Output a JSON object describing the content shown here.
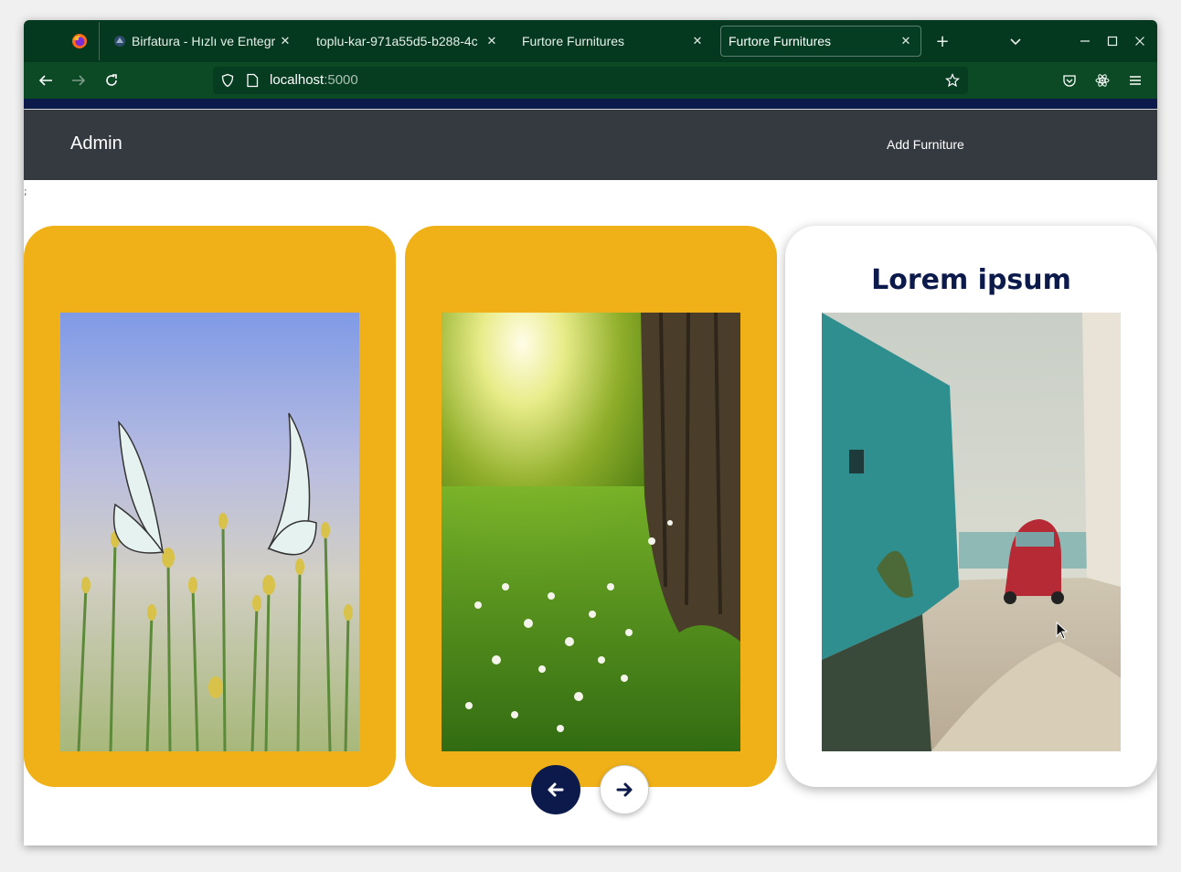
{
  "browser": {
    "tabs": [
      {
        "title": "Birfatura - Hızlı ve Entegr",
        "active": false
      },
      {
        "title": "toplu-kar-971a55d5-b288-4c",
        "active": false
      },
      {
        "title": "Furtore Furnitures",
        "active": false
      },
      {
        "title": "Furtore Furnitures",
        "active": true
      }
    ],
    "url_host": "localhost",
    "url_port": ":5000",
    "accent_color": "#04391f"
  },
  "page": {
    "brand": "Admin",
    "nav_link": "Add Furniture",
    "stray_text": ";",
    "cards": [
      {
        "style": "yellow",
        "title": "",
        "image": "butterflies-on-flowers"
      },
      {
        "style": "yellow",
        "title": "",
        "image": "sunlit-forest-meadow"
      },
      {
        "style": "white",
        "title": "Lorem ipsum",
        "image": "red-beetle-car-alley"
      }
    ],
    "colors": {
      "card_yellow": "#f0b118",
      "navy": "#0b1a4a",
      "header": "#343a40"
    }
  }
}
